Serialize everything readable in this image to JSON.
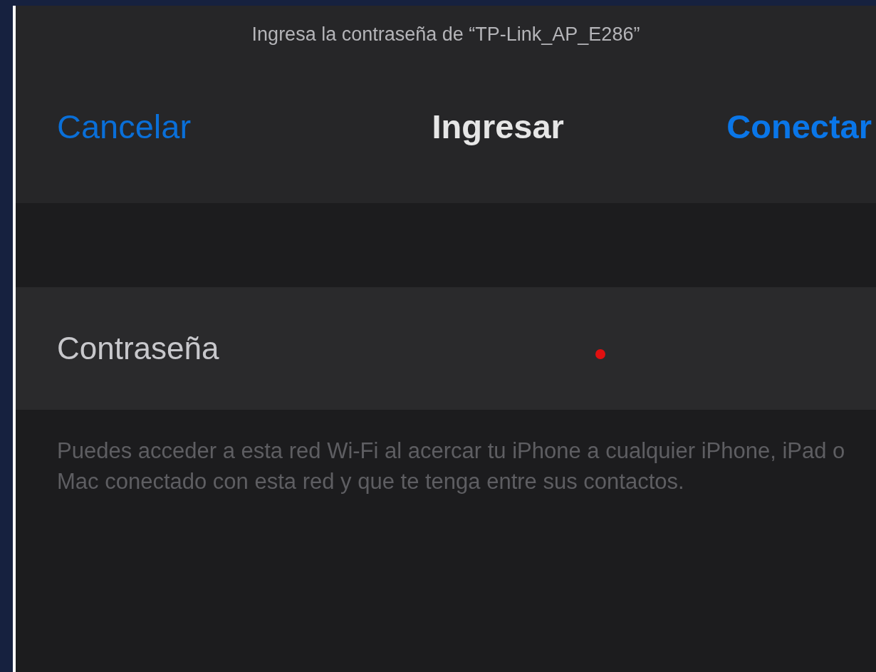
{
  "prompt": "Ingresa la contraseña de “TP-Link_AP_E286”",
  "nav": {
    "cancel": "Cancelar",
    "title": "Ingresar",
    "connect": "Conectar"
  },
  "password_field": {
    "label": "Contraseña"
  },
  "footer_note": "Puedes acceder a esta red Wi-Fi al acercar tu iPhone a cualquier iPhone, iPad o Mac conectado con esta red y que te tenga entre sus contactos."
}
